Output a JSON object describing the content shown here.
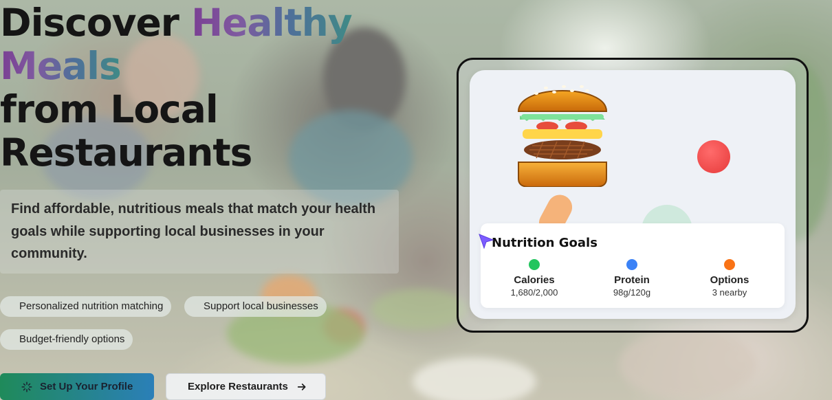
{
  "hero": {
    "title_line1_plain": "Discover ",
    "title_line1_highlight": "Healthy",
    "title_line2_highlight": "Meals",
    "title_line3": "from Local",
    "title_line4": "Restaurants",
    "subtitle": "Find affordable, nutritious meals that match your health goals while supporting local businesses in your community."
  },
  "features": [
    "Personalized nutrition matching",
    "Support local businesses",
    "Budget-friendly options"
  ],
  "actions": {
    "primary_label": "Set Up Your Profile",
    "secondary_label": "Explore Restaurants"
  },
  "nutrition_card": {
    "title": "Nutrition Goals",
    "stats": [
      {
        "label": "Calories",
        "value": "1,680/2,000",
        "color": "#22c55e"
      },
      {
        "label": "Protein",
        "value": "98g/120g",
        "color": "#3b82f6"
      },
      {
        "label": "Options",
        "value": "3 nearby",
        "color": "#f97316"
      }
    ]
  },
  "icons": {
    "primary_button": "sparkle-icon",
    "secondary_button": "arrow-right-icon",
    "illustration": "burger-icon",
    "pointer": "cursor-icon"
  },
  "colors": {
    "brand_green": "#1f8a5a",
    "brand_blue": "#2b7fb8",
    "highlight_purple": "#7a3f93",
    "highlight_teal": "#3f8a86"
  }
}
